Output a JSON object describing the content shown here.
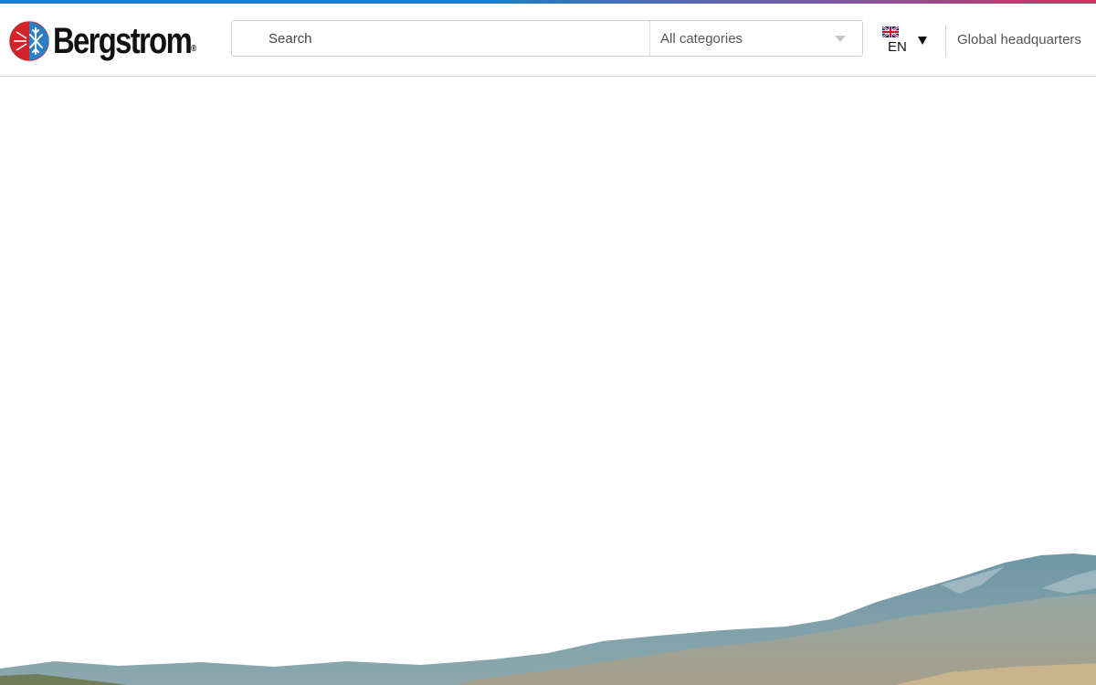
{
  "brand": {
    "name": "Bergstrom",
    "registered_mark": "®",
    "colors": {
      "red": "#d2232a",
      "blue": "#2b7fc2",
      "accent_start": "#1f7fc4",
      "accent_end": "#d2335e"
    }
  },
  "header": {
    "search": {
      "placeholder": "Search",
      "icon": "search-icon"
    },
    "category_select": {
      "selected": "All categories"
    },
    "language": {
      "code": "EN",
      "flag": "uk-flag-icon"
    },
    "hq_link": "Global headquarters"
  },
  "hero": {
    "image": "mountain-landscape"
  }
}
